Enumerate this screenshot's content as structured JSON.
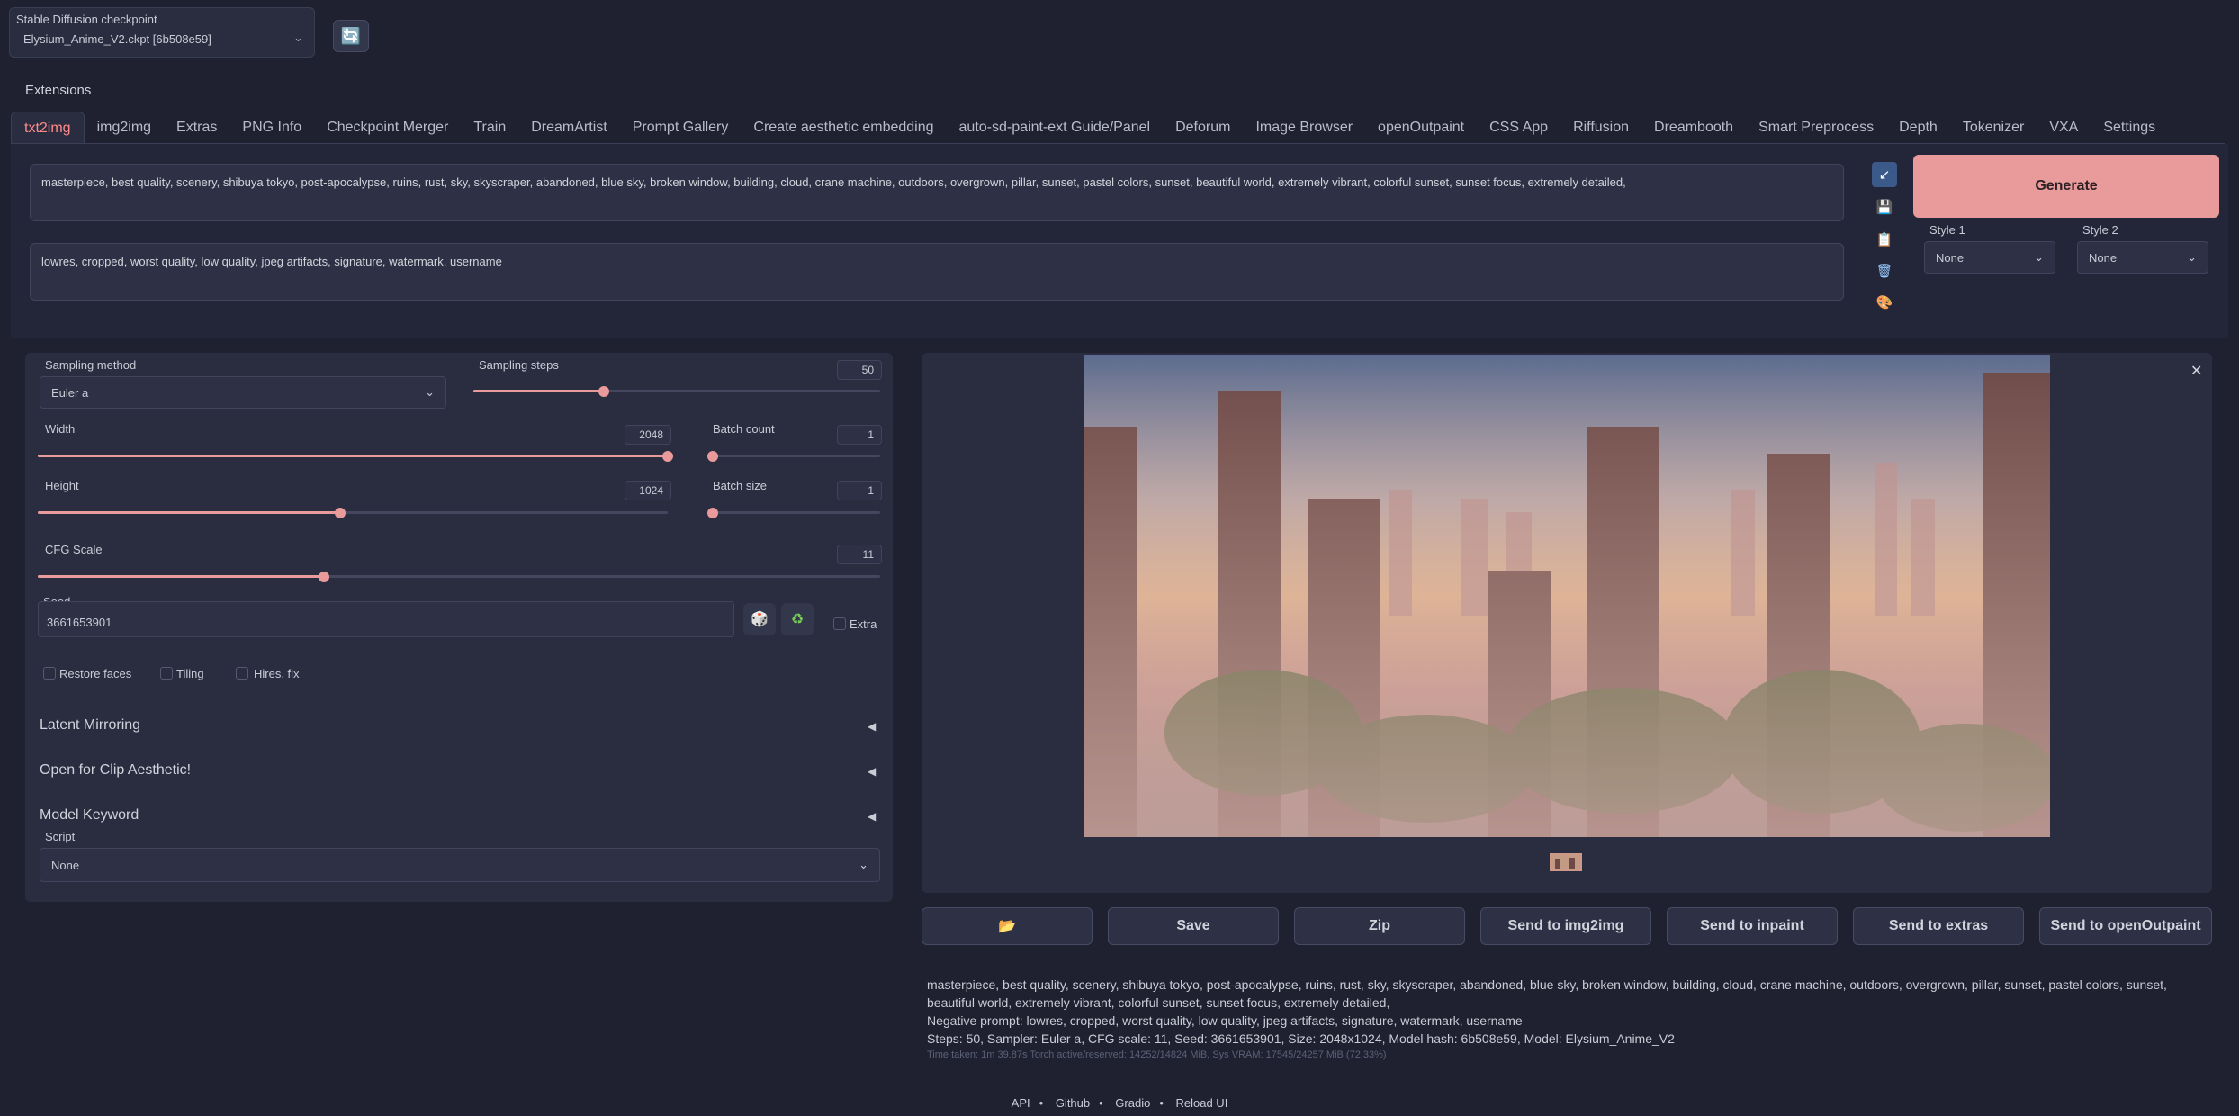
{
  "checkpoint": {
    "title": "Stable Diffusion checkpoint",
    "value": "Elysium_Anime_V2.ckpt [6b508e59]",
    "refresh_icon": "refresh-icon"
  },
  "extensions_label": "Extensions",
  "tabs": [
    {
      "label": "txt2img",
      "active": true
    },
    {
      "label": "img2img"
    },
    {
      "label": "Extras"
    },
    {
      "label": "PNG Info"
    },
    {
      "label": "Checkpoint Merger"
    },
    {
      "label": "Train"
    },
    {
      "label": "DreamArtist"
    },
    {
      "label": "Prompt Gallery"
    },
    {
      "label": "Create aesthetic embedding"
    },
    {
      "label": "auto-sd-paint-ext Guide/Panel"
    },
    {
      "label": "Deforum"
    },
    {
      "label": "Image Browser"
    },
    {
      "label": "openOutpaint"
    },
    {
      "label": "CSS App"
    },
    {
      "label": "Riffusion"
    },
    {
      "label": "Dreambooth"
    },
    {
      "label": "Smart Preprocess"
    },
    {
      "label": "Depth"
    },
    {
      "label": "Tokenizer"
    },
    {
      "label": "VXA"
    },
    {
      "label": "Settings"
    }
  ],
  "prompt": "masterpiece, best quality, scenery, shibuya tokyo, post-apocalypse, ruins, rust, sky, skyscraper, abandoned, blue sky, broken window, building, cloud, crane machine, outdoors, overgrown, pillar, sunset, pastel colors, sunset, beautiful world, extremely vibrant, colorful sunset, sunset focus, extremely detailed,",
  "negative_prompt": "lowres, cropped, worst quality, low quality, jpeg artifacts, signature, watermark, username",
  "generate_label": "Generate",
  "style1": {
    "label": "Style 1",
    "value": "None"
  },
  "style2": {
    "label": "Style 2",
    "value": "None"
  },
  "params": {
    "sampling_method_label": "Sampling method",
    "sampling_method": "Euler a",
    "sampling_steps_label": "Sampling steps",
    "sampling_steps": "50",
    "sampling_steps_fraction": 0.32,
    "width_label": "Width",
    "width": "2048",
    "width_fraction": 1.0,
    "height_label": "Height",
    "height": "1024",
    "height_fraction": 0.48,
    "batch_count_label": "Batch count",
    "batch_count": "1",
    "batch_size_label": "Batch size",
    "batch_size": "1",
    "cfg_label": "CFG Scale",
    "cfg": "11",
    "cfg_fraction": 0.34,
    "seed_label": "Seed",
    "seed": "3661653901",
    "extra_label": "Extra",
    "restore_faces_label": "Restore faces",
    "tiling_label": "Tiling",
    "hires_label": "Hires. fix"
  },
  "accordions": [
    "Latent Mirroring",
    "Open for Clip Aesthetic!",
    "Model Keyword"
  ],
  "script_label": "Script",
  "script_value": "None",
  "actions": {
    "folder_icon": "📂",
    "save": "Save",
    "zip": "Zip",
    "img2img": "Send to img2img",
    "inpaint": "Send to inpaint",
    "extras": "Send to extras",
    "outpaint": "Send to openOutpaint"
  },
  "info": {
    "prompt": "masterpiece, best quality, scenery, shibuya tokyo, post-apocalypse, ruins, rust, sky, skyscraper, abandoned, blue sky, broken window, building, cloud, crane machine, outdoors, overgrown, pillar, sunset, pastel colors, sunset, beautiful world, extremely vibrant, colorful sunset, sunset focus, extremely detailed,",
    "negative": "Negative prompt: lowres, cropped, worst quality, low quality, jpeg artifacts, signature, watermark, username",
    "steps": "Steps: 50, Sampler: Euler a, CFG scale: 11, Seed: 3661653901, Size: 2048x1024, Model hash: 6b508e59, Model: Elysium_Anime_V2",
    "time": "Time taken: 1m 39.87s  Torch active/reserved: 14252/14824 MiB, Sys VRAM: 17545/24257 MiB (72.33%)"
  },
  "footer": [
    "API",
    "Github",
    "Gradio",
    "Reload UI"
  ],
  "colors": {
    "accent": "#e99a9a",
    "bg": "#1f2130",
    "panel": "#2a2d3f"
  }
}
